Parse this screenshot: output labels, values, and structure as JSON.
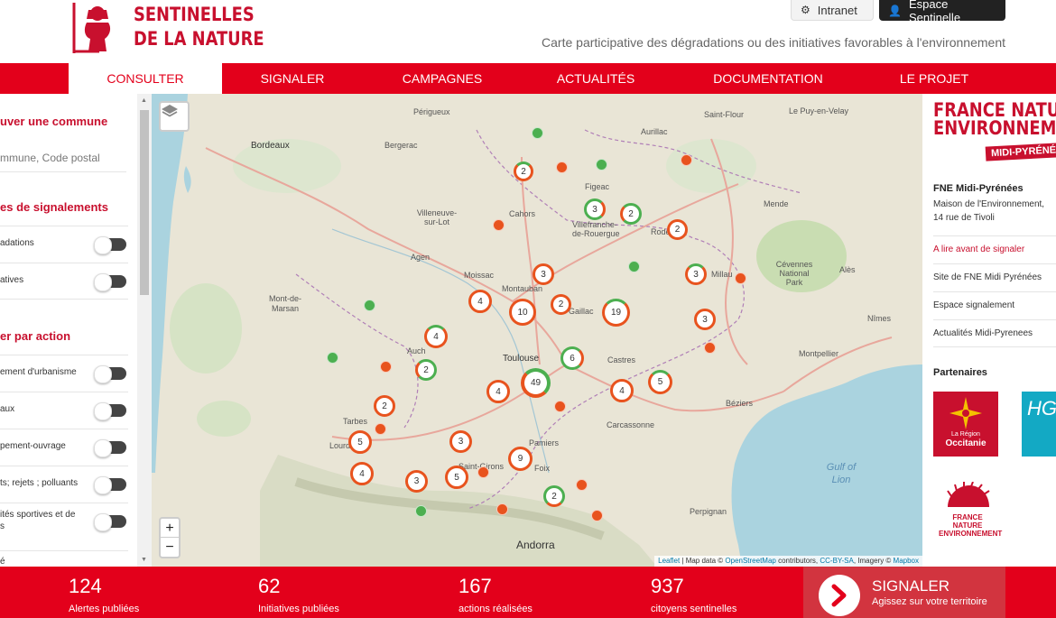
{
  "header": {
    "logo_text_line1": "SENTINELLES",
    "logo_text_line2": "DE LA NATURE",
    "intranet_label": "Intranet",
    "espace_label": "Espace Sentinelle",
    "tagline": "Carte participative des dégradations ou des initiatives favorables à l'environnement",
    "brand_color": "#e3001b"
  },
  "nav": {
    "items": [
      {
        "label": "CONSULTER",
        "active": true
      },
      {
        "label": "SIGNALER",
        "active": false
      },
      {
        "label": "CAMPAGNES",
        "active": false
      },
      {
        "label": "ACTUALITÉS",
        "active": false
      },
      {
        "label": "DOCUMENTATION",
        "active": false
      },
      {
        "label": "LE PROJET",
        "active": false
      }
    ]
  },
  "sidebar": {
    "search_title": "uver une commune",
    "search_placeholder": "mmune, Code postal",
    "types_title": "es de signalements",
    "types": [
      {
        "label": "adations"
      },
      {
        "label": "atives"
      }
    ],
    "action_title": "er par action",
    "actions": [
      {
        "label": "ement d'urbanisme"
      },
      {
        "label": "aux"
      },
      {
        "label": "pement-ouvrage"
      },
      {
        "label": "ts; rejets ; polluants"
      },
      {
        "label": "ités sportives et de",
        "label2": "s"
      },
      {
        "label": "é"
      }
    ]
  },
  "map": {
    "layers_icon": "layers-icon",
    "zoom_in": "+",
    "zoom_out": "−",
    "attribution": {
      "leaflet": "Leaflet",
      "text1": " | Map data © ",
      "osm": "OpenStreetMap",
      "text2": " contributors, ",
      "ccbysa": "CC-BY-SA",
      "text3": ", Imagery © ",
      "mapbox": "Mapbox"
    },
    "places": [
      {
        "name": "Bordeaux",
        "big": true
      },
      {
        "name": "Bergerac"
      },
      {
        "name": "Périgueux"
      },
      {
        "name": "Saint-Flour"
      },
      {
        "name": "Le Puy-en-Velay"
      },
      {
        "name": "Aurillac"
      },
      {
        "name": "Figeac"
      },
      {
        "name": "Cahors"
      },
      {
        "name": "Villefranche-de-Rouergue"
      },
      {
        "name": "Rodez"
      },
      {
        "name": "Mende"
      },
      {
        "name": "Agen"
      },
      {
        "name": "Moissac"
      },
      {
        "name": "Montauban"
      },
      {
        "name": "Gaillac"
      },
      {
        "name": "Millau"
      },
      {
        "name": "Alès"
      },
      {
        "name": "Mont-de-Marsan"
      },
      {
        "name": "Auch"
      },
      {
        "name": "Toulouse",
        "big": true
      },
      {
        "name": "Castres"
      },
      {
        "name": "Nîmes"
      },
      {
        "name": "Montpellier"
      },
      {
        "name": "Béziers"
      },
      {
        "name": "Carcassonne"
      },
      {
        "name": "Tarbes"
      },
      {
        "name": "Lourdes"
      },
      {
        "name": "Pamiers"
      },
      {
        "name": "Saint-Girons"
      },
      {
        "name": "Foix"
      },
      {
        "name": "Perpignan"
      },
      {
        "name": "Andorra",
        "big": true
      },
      {
        "name": "Villeneuve-sur-Lot"
      },
      {
        "name": "Cévennes National Park"
      },
      {
        "name": "Gulf of Lion",
        "sea": true
      }
    ],
    "clusters": [
      {
        "count": 2
      },
      {
        "count": 3
      },
      {
        "count": 2
      },
      {
        "count": 2
      },
      {
        "count": 3
      },
      {
        "count": 3
      },
      {
        "count": 4
      },
      {
        "count": 2
      },
      {
        "count": 10
      },
      {
        "count": 19
      },
      {
        "count": 3
      },
      {
        "count": 4
      },
      {
        "count": 2
      },
      {
        "count": 6
      },
      {
        "count": 49
      },
      {
        "count": 4
      },
      {
        "count": 4
      },
      {
        "count": 5
      },
      {
        "count": 2
      },
      {
        "count": 5
      },
      {
        "count": 3
      },
      {
        "count": 9
      },
      {
        "count": 4
      },
      {
        "count": 3
      },
      {
        "count": 5
      },
      {
        "count": 2
      }
    ],
    "colors": {
      "degradation": "#e8531e",
      "initiative": "#4caf50"
    }
  },
  "right_panel": {
    "fne_line1": "FRANCE NATURE",
    "fne_line2": "ENVIRONNEMENT",
    "fne_region": "MIDI-PYRÉNÉES",
    "org_name": "FNE Midi-Pyrénées",
    "address_line1": "Maison de l'Environnement,",
    "address_line2": "14 rue de Tivoli",
    "links": [
      {
        "label": "A lire avant de signaler",
        "highlight": true
      },
      {
        "label": "Site de FNE Midi Pyrénées",
        "highlight": false
      },
      {
        "label": "Espace signalement",
        "highlight": false
      },
      {
        "label": "Actualités Midi-Pyrenees",
        "highlight": false
      }
    ],
    "partners_title": "Partenaires",
    "occitanie_small": "La Région",
    "occitanie_name": "Occitanie",
    "hg_mark": "HG",
    "fne2_line1": "FRANCE NATURE",
    "fne2_line2": "ENVIRONNEMENT"
  },
  "footer": {
    "stats": [
      {
        "value": "124",
        "label": "Alertes publiées"
      },
      {
        "value": "62",
        "label": "Initiatives publiées"
      },
      {
        "value": "167",
        "label": "actions réalisées"
      },
      {
        "value": "937",
        "label": "citoyens sentinelles"
      }
    ],
    "signaler_title": "SIGNALER",
    "signaler_sub": "Agissez sur votre territoire"
  }
}
